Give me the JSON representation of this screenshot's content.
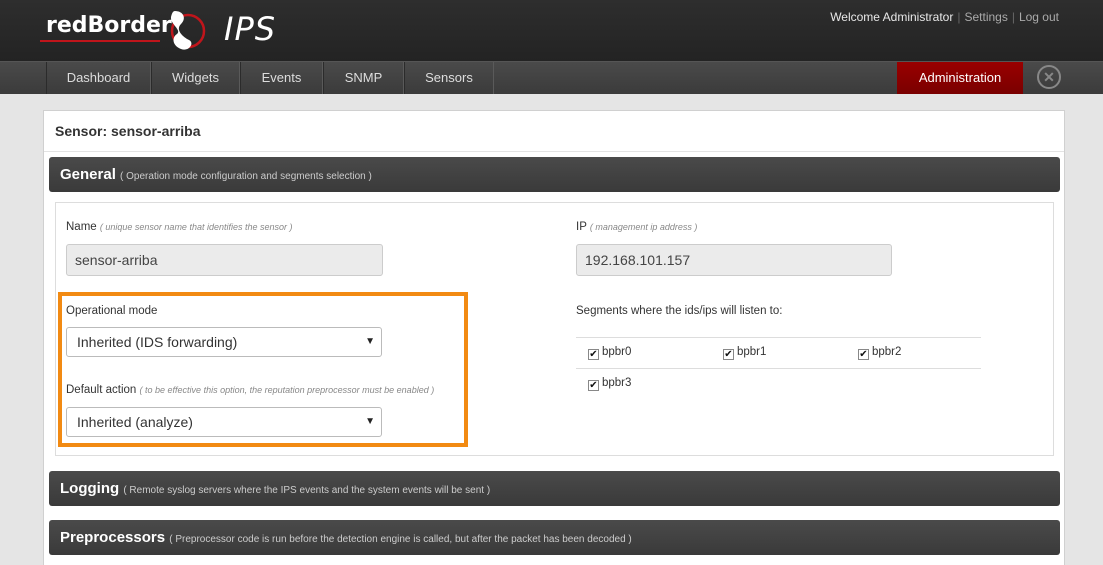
{
  "header": {
    "brand": "redBorder",
    "product": "IPS",
    "welcome": "Welcome Administrator",
    "settings_link": "Settings",
    "logout_link": "Log out"
  },
  "nav": {
    "items": [
      "Dashboard",
      "Widgets",
      "Events",
      "SNMP",
      "Sensors"
    ],
    "admin": "Administration",
    "close_glyph": "✕"
  },
  "page": {
    "title": "Sensor: sensor-arriba"
  },
  "sections": {
    "general": {
      "title": "General",
      "desc": "( Operation mode configuration and segments selection )"
    },
    "logging": {
      "title": "Logging",
      "desc": "( Remote syslog servers where the IPS events and the system events will be sent )"
    },
    "preprocessors": {
      "title": "Preprocessors",
      "desc": "( Preprocessor code is run before the detection engine is called, but after the packet has been decoded )"
    }
  },
  "form": {
    "name_label": "Name",
    "name_hint": "( unique sensor name that identifies the sensor )",
    "name_value": "sensor-arriba",
    "ip_label": "IP",
    "ip_hint": "( management ip address )",
    "ip_value": "192.168.101.157",
    "opmode_label": "Operational mode",
    "opmode_value": "Inherited (IDS forwarding)",
    "default_action_label": "Default action",
    "default_action_hint": "( to be effective this option, the reputation preprocessor must be enabled )",
    "default_action_value": "Inherited (analyze)",
    "segments_label": "Segments where the ids/ips will listen to:",
    "segments": [
      {
        "name": "bpbr0",
        "checked": true
      },
      {
        "name": "bpbr1",
        "checked": true
      },
      {
        "name": "bpbr2",
        "checked": true
      },
      {
        "name": "bpbr3",
        "checked": true
      }
    ]
  },
  "colors": {
    "accent_red": "#8a0000",
    "highlight_orange": "#f28a12"
  }
}
